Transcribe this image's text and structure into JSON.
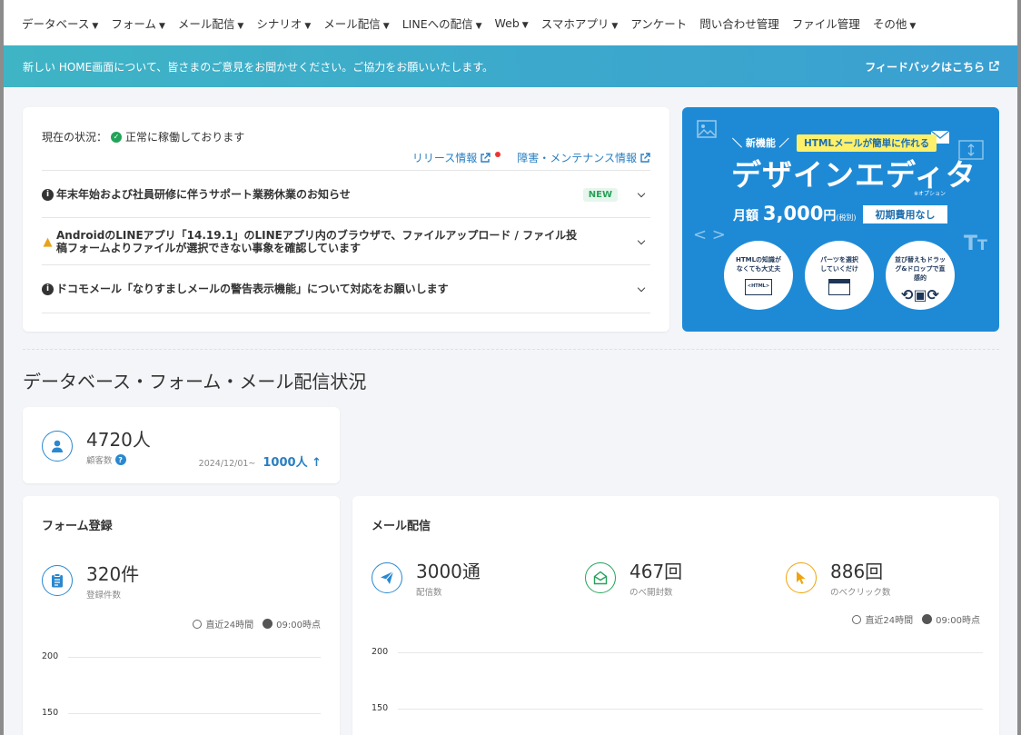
{
  "nav": {
    "items": [
      {
        "label": "データベース",
        "caret": true
      },
      {
        "label": "フォーム",
        "caret": true
      },
      {
        "label": "メール配信",
        "caret": true
      },
      {
        "label": "シナリオ",
        "caret": true
      },
      {
        "label": "メール配信",
        "caret": true
      },
      {
        "label": "LINEへの配信",
        "caret": true
      },
      {
        "label": "Web",
        "caret": true
      },
      {
        "label": "スマホアプリ",
        "caret": true
      },
      {
        "label": "アンケート",
        "caret": false
      },
      {
        "label": "問い合わせ管理",
        "caret": false
      },
      {
        "label": "ファイル管理",
        "caret": false
      },
      {
        "label": "その他",
        "caret": true
      }
    ]
  },
  "banner": {
    "message": "新しい HOME画面について、皆さまのご意見をお聞かせください。ご協力をお願いいたします。",
    "link": "フィードバックはこちら"
  },
  "status": {
    "label": "現在の状況：",
    "value": "正常に稼働しております",
    "release_link": "リリース情報",
    "maintenance_link": "障害・メンテナンス情報"
  },
  "notices": [
    {
      "icon": "info",
      "text": "年末年始および社員研修に伴うサポート業務休業のお知らせ",
      "badge": "NEW"
    },
    {
      "icon": "warning",
      "text": "AndroidのLINEアプリ「14.19.1」のLINEアプリ内のブラウザで、ファイルアップロード / ファイル投稿フォームよりファイルが選択できない事象を確認しています",
      "badge": ""
    },
    {
      "icon": "info",
      "text": "ドコモメール「なりすましメールの警告表示機能」について対応をお願いします",
      "badge": ""
    }
  ],
  "promo": {
    "new_feature": "＼ 新機能 ／",
    "pill": "HTMLメールが簡単に作れる",
    "headline": "デザインエディタ",
    "option_note": "※オプション",
    "price_prefix": "月額",
    "price": "3,000",
    "price_unit": "円",
    "price_tax": "(税別)",
    "free_label": "初期費用なし",
    "circle1": "HTMLの知識がなくても大丈夫",
    "circle2": "パーツを選択していくだけ",
    "circle3": "並び替えもドラッグ&ドロップで直感的"
  },
  "section": {
    "title": "データベース・フォーム・メール配信状況"
  },
  "customers": {
    "value": "4720人",
    "label": "顧客数",
    "since_date": "2024/12/01~",
    "since_value": "1000人 ↑"
  },
  "form_card": {
    "title": "フォーム登録",
    "value": "320件",
    "label": "登録件数",
    "period": "直近24時間",
    "time": "09:00時点",
    "y_ticks": [
      "200",
      "150"
    ]
  },
  "mail_card": {
    "title": "メール配信",
    "sent_value": "3000通",
    "sent_label": "配信数",
    "open_value": "467回",
    "open_label": "のべ開封数",
    "click_value": "886回",
    "click_label": "のべクリック数",
    "period": "直近24時間",
    "time": "09:00時点",
    "y_ticks": [
      "200",
      "150"
    ]
  },
  "colors": {
    "accent": "#2a88d0",
    "banner_start": "#3fb4c5",
    "banner_end": "#3a9fd2",
    "promo": "#1e8ad6",
    "ok": "#22a35a",
    "warn": "#e9a21b",
    "open": "#22a35a",
    "click": "#f0a30a"
  }
}
